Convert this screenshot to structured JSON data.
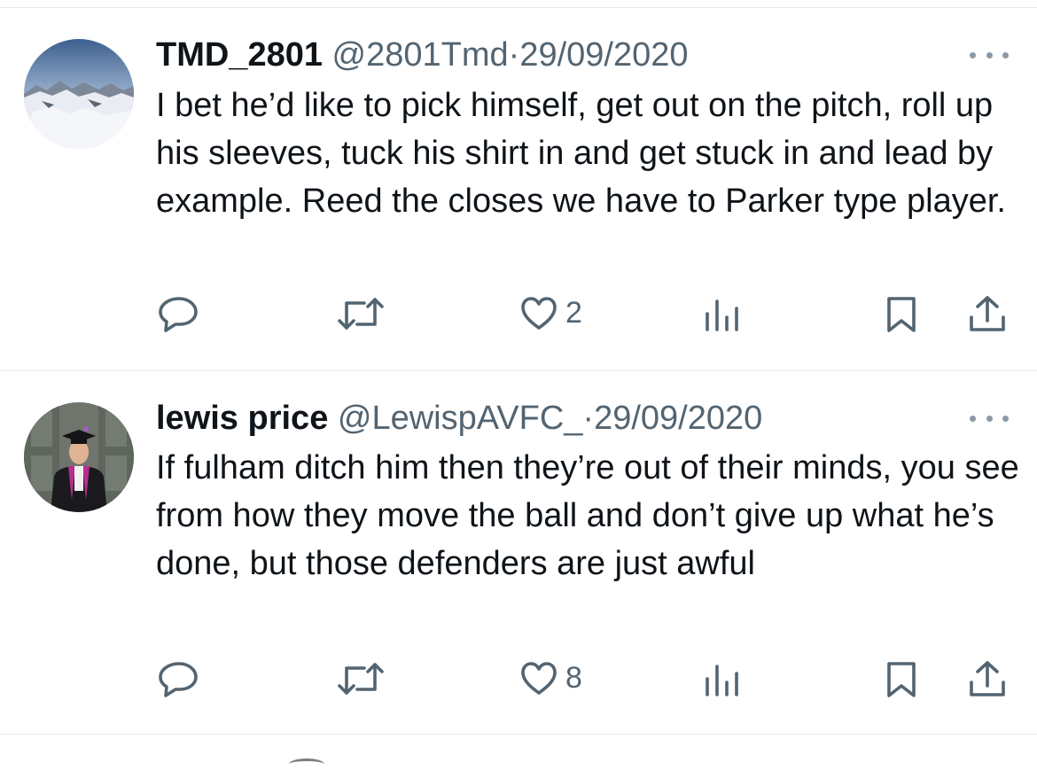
{
  "tweets": [
    {
      "name": "TMD_2801",
      "handle": "@2801Tmd",
      "separator": "·",
      "date": "29/09/2020",
      "text": "I bet he’d like to pick himself, get out on the pitch, roll up his sleeves, tuck his shirt in and get stuck in and lead by example.  Reed the closes we have to Parker type player.",
      "likes": "2",
      "avatar": "mountain-landscape"
    },
    {
      "name": "lewis price",
      "handle": "@LewispAVFC_",
      "separator": "·",
      "date": "29/09/2020",
      "text": "If fulham ditch him then they’re out of their minds, you see from how they move the ball and don’t give up what he’s done, but those defenders are just awful",
      "likes": "8",
      "avatar": "graduate-portrait"
    }
  ],
  "colors": {
    "text": "#0f1419",
    "secondary": "#536471",
    "divider": "#e6e9ec"
  },
  "icons": [
    "reply-icon",
    "retweet-icon",
    "heart-icon",
    "views-icon",
    "bookmark-icon",
    "share-icon",
    "more-icon"
  ]
}
